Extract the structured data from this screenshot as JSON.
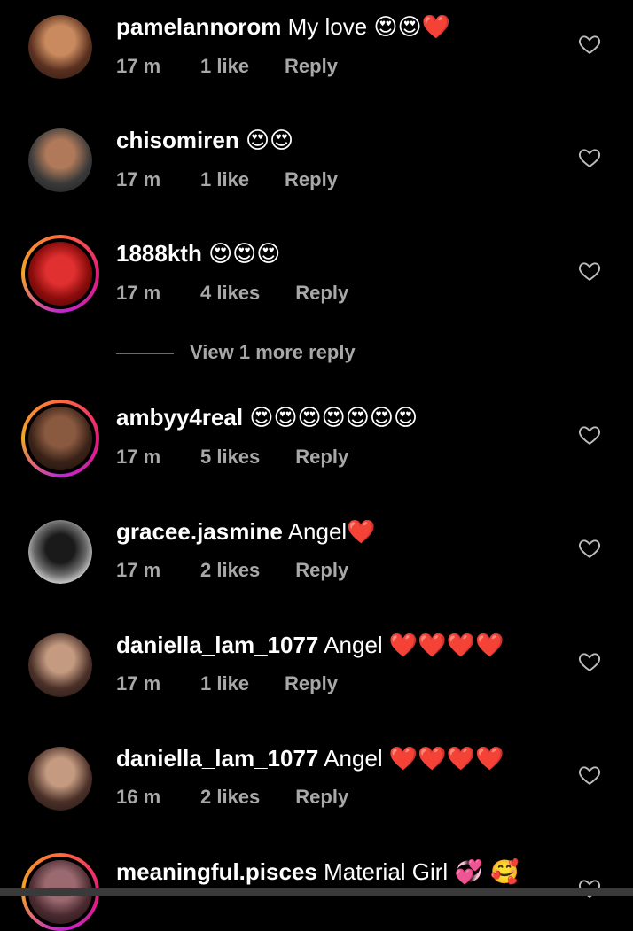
{
  "comments": [
    {
      "username": "pamelannorom",
      "text": "My love",
      "emoji": "😍😍❤️",
      "time": "17 m",
      "likes": "1 like",
      "reply": "Reply",
      "avatar_color": "#8a5a3b",
      "story": false
    },
    {
      "username": "chisomiren",
      "text": "",
      "emoji": "😍😍",
      "time": "17 m",
      "likes": "1 like",
      "reply": "Reply",
      "avatar_color": "#4a3b2e",
      "story": false
    },
    {
      "username": "1888kth",
      "text": "",
      "emoji": "😍😍😍",
      "time": "17 m",
      "likes": "4 likes",
      "reply": "Reply",
      "avatar_color": "#b01818",
      "story": true
    },
    {
      "username": "ambyy4real",
      "text": "",
      "emoji": "😍😍😍😍😍😍😍",
      "time": "17 m",
      "likes": "5 likes",
      "reply": "Reply",
      "avatar_color": "#6b4a3a",
      "story": true
    },
    {
      "username": "gracee.jasmine",
      "text": "Angel",
      "emoji": "❤️",
      "time": "17 m",
      "likes": "2 likes",
      "reply": "Reply",
      "avatar_color": "#d9d9d9",
      "story": false
    },
    {
      "username": "daniella_lam_1077",
      "text": "Angel",
      "emoji": "❤️❤️❤️❤️",
      "time": "17 m",
      "likes": "1 like",
      "reply": "Reply",
      "avatar_color": "#3a2c28",
      "story": false
    },
    {
      "username": "daniella_lam_1077",
      "text": "Angel",
      "emoji": "❤️❤️❤️❤️",
      "time": "16 m",
      "likes": "2 likes",
      "reply": "Reply",
      "avatar_color": "#3a2c28",
      "story": false
    },
    {
      "username": "meaningful.pisces",
      "text": "Material Girl",
      "emoji": "💞 🥰",
      "time": "",
      "likes": "",
      "reply": "",
      "avatar_color": "#5a3a40",
      "story": true
    }
  ],
  "view_more_label": "View 1 more reply",
  "icons": {
    "like": "heart-outline-icon"
  }
}
